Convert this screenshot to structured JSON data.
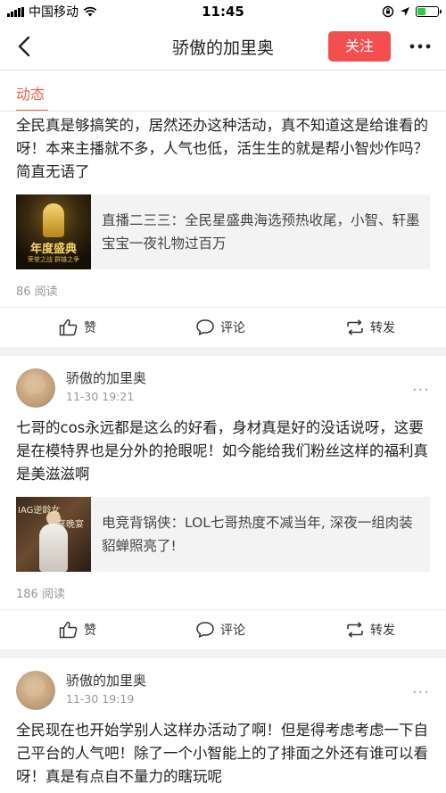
{
  "status_bar": {
    "carrier": "中国移动",
    "time": "11:45"
  },
  "header": {
    "title": "骄傲的加里奥",
    "follow_label": "关注"
  },
  "tabs": [
    {
      "label": "动态"
    }
  ],
  "posts": [
    {
      "text": "全民真是够搞笑的，居然还办这种活动，真不知道这是给谁看的呀！本来主播就不多，人气也低，活生生的就是帮小智炒作吗？简直无语了",
      "share_title": "直播二三三：全民星盛典海选预热收尾，小智、轩墨宝宝一夜礼物过百万",
      "thumb_text": "年度盛典",
      "thumb_subtext": "荣誉之战 群雄之争",
      "reads": "86 阅读",
      "like": "赞",
      "comment": "评论",
      "repost": "转发"
    },
    {
      "author": "骄傲的加里奥",
      "time": "11-30 19:21",
      "text": "七哥的cos永远都是这么的好看，身材真是好的没话说呀，这要是在模特界也是分外的抢眼呢！如今能给我们粉丝这样的福利真是美滋滋啊",
      "share_title": "电竞背锅侠：LOL七哥热度不减当年, 深夜一组肉装貂蝉照亮了!",
      "thumb_text": "IAG逆龄女",
      "thumb_subtext": "享晚宴",
      "reads": "186 阅读",
      "like": "赞",
      "comment": "评论",
      "repost": "转发"
    },
    {
      "author": "骄傲的加里奥",
      "time": "11-30 19:19",
      "text": "全民现在也开始学别人这样办活动了啊！但是得考虑考虑一下自己平台的人气吧！除了一个小智能上的了排面之外还有谁可以看呀！真是有点自不量力的瞎玩呢"
    }
  ],
  "colors": {
    "accent": "#f24f4f",
    "tab_active": "#e8604c",
    "muted": "#999999"
  },
  "icons": [
    "signal-icon",
    "wifi-icon",
    "lock-rotation-icon",
    "location-icon",
    "battery-icon",
    "back-arrow-icon",
    "more-icon",
    "like-icon",
    "comment-icon",
    "repost-icon"
  ]
}
